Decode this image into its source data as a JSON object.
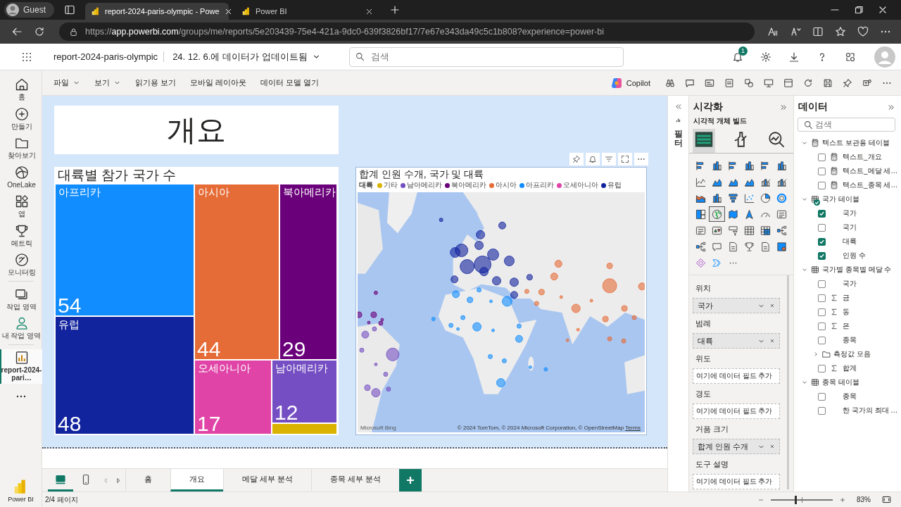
{
  "browser": {
    "profile": "Guest",
    "tabs": [
      {
        "title": "report-2024-paris-olympic - Powe",
        "selected": true
      },
      {
        "title": "Power BI",
        "selected": false
      }
    ],
    "url": {
      "scheme": "https://",
      "host": "app.powerbi.com",
      "path": "/groups/me/reports/5e203439-75e4-421a-9dc0-639f3826bf17/7e67e343da49c5c1b808?experience=power-bi"
    }
  },
  "header": {
    "report_name": "report-2024-paris-olympic",
    "refresh": "24. 12. 6.에 데이터가 업데이트됨",
    "search_placeholder": "검색",
    "notifications": "1"
  },
  "nav": [
    {
      "label": "홈",
      "kind": "home",
      "selected": false
    },
    {
      "label": "만들기",
      "kind": "create",
      "selected": false
    },
    {
      "label": "찾아보기",
      "kind": "browse",
      "selected": false
    },
    {
      "label": "OneLake",
      "kind": "onelake",
      "selected": false
    },
    {
      "label": "앱",
      "kind": "apps",
      "selected": false
    },
    {
      "label": "메트릭",
      "kind": "metrics",
      "selected": false
    },
    {
      "label": "모니터링",
      "kind": "monitor",
      "selected": false
    },
    {
      "label": "작업 영역",
      "kind": "workspaces",
      "selected": false
    },
    {
      "label": "내 작업 영역",
      "kind": "my-workspace",
      "selected": false
    },
    {
      "label": "report-2024-pari…",
      "kind": "report",
      "selected": true
    }
  ],
  "brand": "Power BI",
  "toolbar": {
    "menus": [
      {
        "label": "파일",
        "dropdown": true
      },
      {
        "label": "보기",
        "dropdown": true
      },
      {
        "label": "읽기용 보기",
        "dropdown": false
      },
      {
        "label": "모바일 레이아웃",
        "dropdown": false
      },
      {
        "label": "데이터 모델 열기",
        "dropdown": false
      }
    ],
    "copilot": "Copilot"
  },
  "page": {
    "title": "개요",
    "treemap": {
      "title": "대륙별 참가 국가 수",
      "tiles": [
        {
          "label": "아프리카",
          "count": "54",
          "color": "#118dff"
        },
        {
          "label": "유럽",
          "count": "48",
          "color": "#12239e"
        },
        {
          "label": "아시아",
          "count": "44",
          "color": "#e66c37"
        },
        {
          "label": "북아메리카",
          "count": "29",
          "color": "#6b007b"
        },
        {
          "label": "오세아니아",
          "count": "17",
          "color": "#e044a7"
        },
        {
          "label": "남아메리카",
          "count": "12",
          "color": "#744ec2"
        },
        {
          "color": "#d9b300"
        }
      ]
    },
    "map": {
      "title": "합계 인원 수개, 국가 및 대륙",
      "legend_title": "대륙",
      "legend": [
        {
          "label": "기타",
          "color": "#d9b300"
        },
        {
          "label": "남아메리카",
          "color": "#744ec2"
        },
        {
          "label": "북아메리카",
          "color": "#6b007b"
        },
        {
          "label": "아시아",
          "color": "#e66c37"
        },
        {
          "label": "아프리카",
          "color": "#118dff"
        },
        {
          "label": "오세아니아",
          "color": "#e044a7"
        },
        {
          "label": "유럽",
          "color": "#12239e"
        }
      ],
      "provider": "Microsoft Bing",
      "attribution": "© 2024 TomTom, © 2024 Microsoft Corporation, © OpenStreetMap",
      "terms": "Terms"
    }
  },
  "filters": {
    "label": "필터"
  },
  "visualizations": {
    "title": "시각화",
    "subtitle": "시각적 개체 빌드",
    "build_tabs": [
      {
        "kind": "fields",
        "selected": true
      },
      {
        "kind": "format",
        "selected": false
      },
      {
        "kind": "analytics",
        "selected": false
      }
    ],
    "types": [
      {
        "kind": "bar",
        "selected": false
      },
      {
        "kind": "column",
        "selected": false
      },
      {
        "kind": "bar",
        "selected": false
      },
      {
        "kind": "column",
        "selected": false
      },
      {
        "kind": "bar",
        "selected": false
      },
      {
        "kind": "column",
        "selected": false
      },
      {
        "kind": "line",
        "selected": false
      },
      {
        "kind": "area",
        "selected": false
      },
      {
        "kind": "area",
        "selected": false
      },
      {
        "kind": "area",
        "selected": false
      },
      {
        "kind": "combo",
        "selected": false
      },
      {
        "kind": "combo",
        "selected": false
      },
      {
        "kind": "ribbon",
        "selected": false
      },
      {
        "kind": "column",
        "selected": false
      },
      {
        "kind": "funnel",
        "selected": false
      },
      {
        "kind": "scatter",
        "selected": false
      },
      {
        "kind": "pie",
        "selected": false
      },
      {
        "kind": "donut",
        "selected": false
      },
      {
        "kind": "treemap",
        "selected": false
      },
      {
        "kind": "globe",
        "selected": true
      },
      {
        "kind": "filled-map",
        "selected": false
      },
      {
        "kind": "arrow",
        "selected": false
      },
      {
        "kind": "gauge",
        "selected": false
      },
      {
        "kind": "card",
        "selected": false
      },
      {
        "kind": "card",
        "selected": false
      },
      {
        "kind": "kpi",
        "selected": false
      },
      {
        "kind": "slicer",
        "selected": false
      },
      {
        "kind": "table",
        "selected": false
      },
      {
        "kind": "matrix",
        "selected": false
      },
      {
        "kind": "tree",
        "selected": false
      },
      {
        "kind": "tree",
        "selected": false
      },
      {
        "kind": "chat",
        "selected": false
      },
      {
        "kind": "document",
        "selected": false
      },
      {
        "kind": "trophy",
        "selected": false
      },
      {
        "kind": "document",
        "selected": false
      },
      {
        "kind": "script",
        "selected": false
      },
      {
        "kind": "diamond",
        "selected": false
      },
      {
        "kind": "chevrons",
        "selected": false
      }
    ],
    "more": "···",
    "wells": [
      {
        "label": "위치",
        "field": "국가"
      },
      {
        "label": "범례",
        "field": "대륙"
      },
      {
        "label": "위도",
        "drop_hint": "여기에 데이터 필드 추가"
      },
      {
        "label": "경도",
        "drop_hint": "여기에 데이터 필드 추가"
      },
      {
        "label": "거품 크기",
        "field": "합계 인원 수개"
      },
      {
        "label": "도구 설명",
        "drop_hint": "여기에 데이터 필드 추가"
      }
    ]
  },
  "data": {
    "title": "데이터",
    "search_placeholder": "검색",
    "tree": [
      {
        "label": "텍스트 보관용 테이블",
        "kind": "calc-table",
        "expanded": true,
        "in_use": false,
        "children": [
          {
            "label": "텍스트_개요",
            "kind": "calc",
            "checked": false
          },
          {
            "label": "텍스트_메달 세…",
            "kind": "calc",
            "checked": false
          },
          {
            "label": "텍스트_종목 세…",
            "kind": "calc",
            "checked": false
          }
        ]
      },
      {
        "label": "국가 테이블",
        "kind": "table",
        "expanded": true,
        "in_use": true,
        "children": [
          {
            "label": "국가",
            "kind": "field",
            "checked": true
          },
          {
            "label": "국기",
            "kind": "field",
            "checked": false
          },
          {
            "label": "대륙",
            "kind": "field",
            "checked": true
          },
          {
            "label": "인원 수",
            "kind": "field",
            "checked": true
          }
        ]
      },
      {
        "label": "국가별 종목별 메달 수",
        "kind": "table",
        "expanded": true,
        "in_use": false,
        "children": [
          {
            "label": "국가",
            "kind": "field",
            "checked": false
          },
          {
            "label": "금",
            "kind": "sum",
            "checked": false
          },
          {
            "label": "동",
            "kind": "sum",
            "checked": false
          },
          {
            "label": "은",
            "kind": "sum",
            "checked": false
          },
          {
            "label": "종목",
            "kind": "field",
            "checked": false
          },
          {
            "label": "측정값 모음",
            "kind": "folder",
            "expanded": false
          },
          {
            "label": "합계",
            "kind": "sum",
            "checked": false
          }
        ]
      },
      {
        "label": "종목 테이블",
        "kind": "table",
        "expanded": true,
        "in_use": false,
        "children": [
          {
            "label": "종목",
            "kind": "field",
            "checked": false
          },
          {
            "label": "한 국가의 최대 …",
            "kind": "field",
            "checked": false
          }
        ]
      }
    ]
  },
  "layout_views": [
    {
      "kind": "desktop",
      "selected": true
    },
    {
      "kind": "mobile",
      "selected": false
    }
  ],
  "page_tabs": [
    {
      "label": "홈",
      "selected": false
    },
    {
      "label": "개요",
      "selected": true
    },
    {
      "label": "메달 세부 분석",
      "selected": false
    },
    {
      "label": "종목 세부 분석",
      "selected": false
    }
  ],
  "status": {
    "page": "2/4 페이지",
    "zoom": "83%",
    "zoom_slider": {
      "level": 0.4
    }
  }
}
